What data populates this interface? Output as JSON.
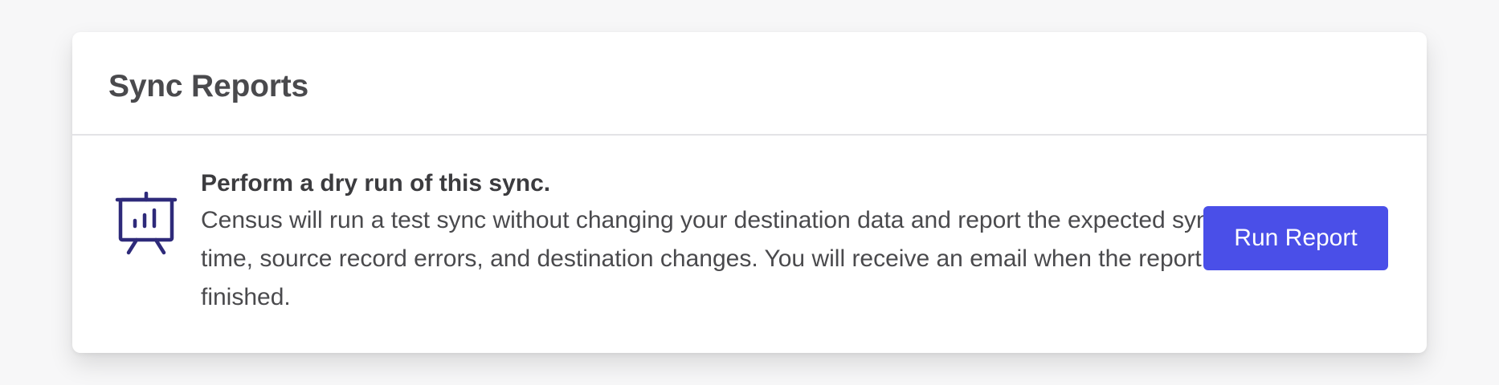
{
  "card": {
    "title": "Sync Reports"
  },
  "dry_run": {
    "icon": "presentation-chart-icon",
    "headline": "Perform a dry run of this sync.",
    "description": "Census will run a test sync without changing your destination data and report the expected sync time, source record errors, and destination changes. You will receive an email when the report is finished.",
    "button_label": "Run Report"
  },
  "colors": {
    "accent": "#4a4fe8",
    "icon": "#2e2a7a",
    "title_text": "#4a4a4d",
    "background": "#f7f7f8"
  }
}
